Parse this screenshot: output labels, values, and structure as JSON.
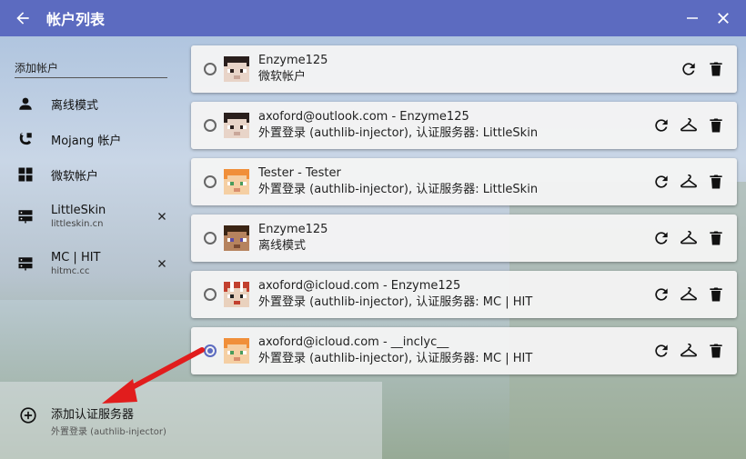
{
  "window": {
    "title": "帐户列表"
  },
  "sidebar": {
    "header": "添加帐户",
    "items": [
      {
        "label": "离线模式",
        "icon": "person-icon"
      },
      {
        "label": "Mojang 帐户",
        "icon": "mojang-icon"
      },
      {
        "label": "微软帐户",
        "icon": "microsoft-icon"
      },
      {
        "label": "LittleSkin",
        "sub": "littleskin.cn",
        "icon": "server-icon"
      },
      {
        "label": "MC | HIT",
        "sub": "hitmc.cc",
        "icon": "server-icon"
      }
    ],
    "add_server": {
      "label": "添加认证服务器",
      "sub": "外置登录 (authlib-injector)"
    }
  },
  "accounts": [
    {
      "name": "Enzyme125",
      "subtitle": "微软帐户",
      "skin": "dark",
      "selected": false
    },
    {
      "name": "axoford@outlook.com - Enzyme125",
      "subtitle": "外置登录 (authlib-injector), 认证服务器: LittleSkin",
      "skin": "dark",
      "selected": false
    },
    {
      "name": "Tester - Tester",
      "subtitle": "外置登录 (authlib-injector), 认证服务器: LittleSkin",
      "skin": "alex",
      "selected": false
    },
    {
      "name": "Enzyme125",
      "subtitle": "离线模式",
      "skin": "steve",
      "selected": false
    },
    {
      "name": "axoford@icloud.com - Enzyme125",
      "subtitle": "外置登录 (authlib-injector), 认证服务器: MC | HIT",
      "skin": "mushroom",
      "selected": false
    },
    {
      "name": "axoford@icloud.com - __inclyc__",
      "subtitle": "外置登录 (authlib-injector), 认证服务器: MC | HIT",
      "skin": "alex",
      "selected": true
    }
  ],
  "colors": {
    "titlebar": "#5c6bc0",
    "accent": "#5c6bc0",
    "arrow": "#e11d1d"
  }
}
